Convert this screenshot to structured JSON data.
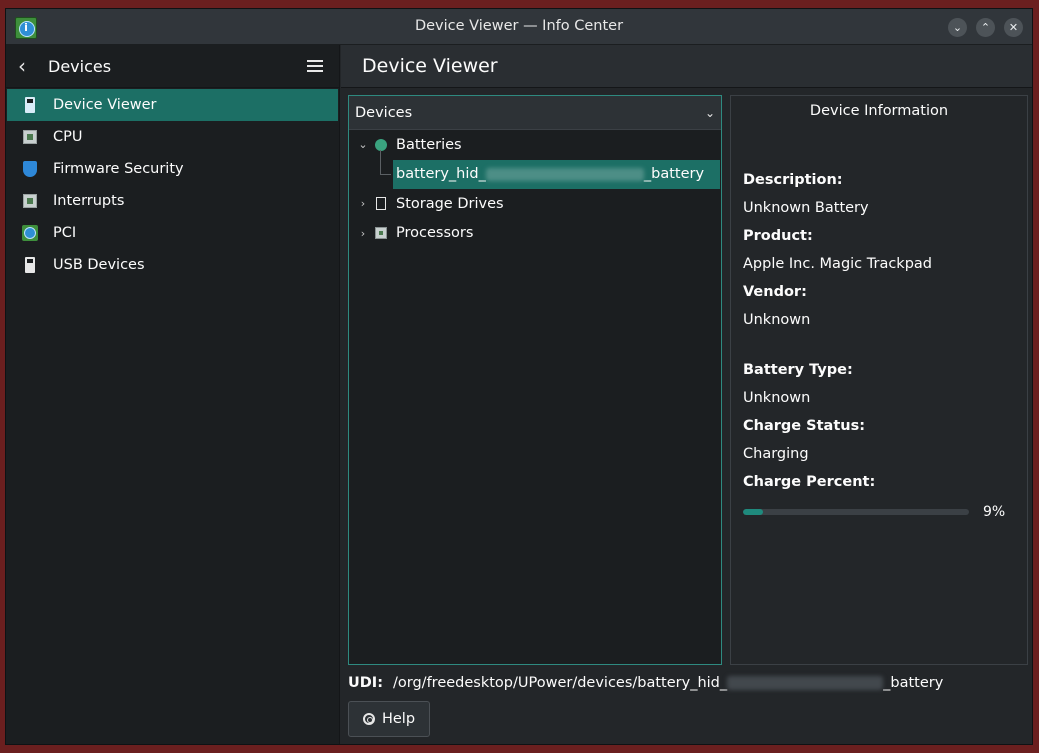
{
  "window": {
    "title": "Device Viewer — Info Center",
    "buttons": [
      {
        "name": "minimize-button",
        "icon": "chevron-down-icon",
        "glyph": "⌄"
      },
      {
        "name": "maximize-button",
        "icon": "chevron-up-icon",
        "glyph": "⌃"
      },
      {
        "name": "close-button",
        "icon": "close-icon",
        "glyph": "✕"
      }
    ]
  },
  "sidebar": {
    "back_icon": "chevron-left-icon",
    "title": "Devices",
    "menu_icon": "hamburger-menu-icon",
    "items": [
      {
        "label": "Device Viewer",
        "icon": "usb-device-icon",
        "active": true
      },
      {
        "label": "CPU",
        "icon": "cpu-chip-icon",
        "active": false
      },
      {
        "label": "Firmware Security",
        "icon": "shield-icon",
        "active": false
      },
      {
        "label": "Interrupts",
        "icon": "chip-icon",
        "active": false
      },
      {
        "label": "PCI",
        "icon": "info-icon",
        "active": false
      },
      {
        "label": "USB Devices",
        "icon": "usb-icon",
        "active": false
      }
    ]
  },
  "main": {
    "title": "Device Viewer",
    "tree": {
      "header": "Devices",
      "nodes": [
        {
          "label": "Batteries",
          "icon": "battery-icon",
          "expanded": true,
          "selected": false
        },
        {
          "label_prefix": "battery_hid_",
          "label_suffix": "_battery",
          "selected": true
        },
        {
          "label": "Storage Drives",
          "icon": "drive-icon",
          "expanded": false,
          "selected": false
        },
        {
          "label": "Processors",
          "icon": "processor-icon",
          "expanded": false,
          "selected": false
        }
      ]
    },
    "info": {
      "title": "Device Information",
      "fields": [
        {
          "label": "Description:",
          "value": "Unknown Battery"
        },
        {
          "label": "Product:",
          "value": "Apple Inc. Magic Trackpad"
        },
        {
          "label": "Vendor:",
          "value": "Unknown"
        },
        {
          "label": "Battery Type:",
          "value": "Unknown"
        },
        {
          "label": "Charge Status:",
          "value": "Charging"
        },
        {
          "label": "Charge Percent:",
          "value": ""
        }
      ],
      "charge_percent": 9,
      "charge_percent_text": "9%"
    },
    "udi": {
      "label": "UDI:",
      "prefix": "/org/freedesktop/UPower/devices/battery_hid_",
      "suffix": "_battery"
    },
    "help_button": "Help"
  },
  "colors": {
    "accent": "#1c6f65",
    "window_bg": "#232629",
    "sidebar_bg": "#1b1e20",
    "progress": "#1f8a7d"
  }
}
